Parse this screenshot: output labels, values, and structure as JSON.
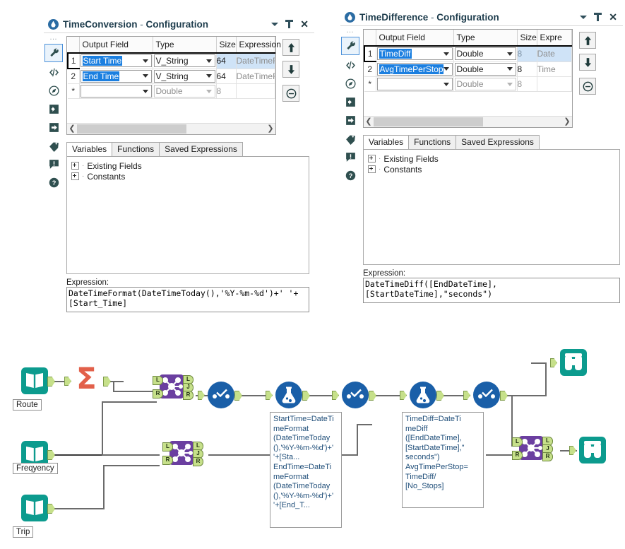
{
  "panels": [
    {
      "id": "time-conversion",
      "title": "TimeConversion",
      "title_sep": " - ",
      "title_suffix": "Configuration",
      "rail_icons": [
        "wrench-icon",
        "code-icon",
        "compass-icon",
        "import-icon",
        "export-icon",
        "tag-icon",
        "warning-icon",
        "help-icon"
      ],
      "grid": {
        "columns": [
          "",
          "Output Field",
          "Type",
          "Size",
          "Expression"
        ],
        "rows": [
          {
            "num": "1",
            "output_field": "Start Time",
            "type": "V_String",
            "size": "64",
            "expression": "DateTimeF",
            "selected": true
          },
          {
            "num": "2",
            "output_field": "End Time",
            "type": "V_String",
            "size": "64",
            "expression": "DateTimeF",
            "selected": false
          },
          {
            "num": "*",
            "output_field": "",
            "type": "Double",
            "size": "8",
            "expression": "",
            "selected": false
          }
        ]
      },
      "grid_buttons": [
        "move-up",
        "move-down",
        "delete"
      ],
      "tabs": [
        "Variables",
        "Functions",
        "Saved Expressions"
      ],
      "active_tab": "Variables",
      "tree_items": [
        "Existing Fields",
        "Constants"
      ],
      "expression_label": "Expression:",
      "expression": "DateTimeFormat(DateTimeToday(),'%Y-%m-%d')+' '+\n[Start_Time]"
    },
    {
      "id": "time-difference",
      "title": "TimeDifference",
      "title_sep": " - ",
      "title_suffix": "Configuration",
      "rail_icons": [
        "wrench-icon",
        "code-icon",
        "compass-icon",
        "import-icon",
        "export-icon",
        "tag-icon",
        "warning-icon",
        "help-icon"
      ],
      "grid": {
        "columns": [
          "",
          "Output Field",
          "Type",
          "Size",
          "Expre"
        ],
        "rows": [
          {
            "num": "1",
            "output_field": "TimeDiff",
            "type": "Double",
            "size": "8",
            "expression": "Date",
            "selected": true
          },
          {
            "num": "2",
            "output_field": "AvgTimePerStop",
            "type": "Double",
            "size": "8",
            "expression": "Time",
            "selected": false
          },
          {
            "num": "*",
            "output_field": "",
            "type": "Double",
            "size": "8",
            "expression": "",
            "selected": false
          }
        ]
      },
      "grid_buttons": [
        "move-up",
        "move-down",
        "delete"
      ],
      "tabs": [
        "Variables",
        "Functions",
        "Saved Expressions"
      ],
      "active_tab": "Variables",
      "tree_items": [
        "Existing Fields",
        "Constants"
      ],
      "expression_label": "Expression:",
      "expression": "DateTimeDiff([EndDateTime],\n[StartDateTime],\"seconds\")"
    }
  ],
  "canvas": {
    "node_labels": [
      {
        "name": "route-label",
        "text": "Route"
      },
      {
        "name": "frequency-label",
        "text": "Freqyency"
      },
      {
        "name": "trip-label",
        "text": "Trip"
      }
    ],
    "annotations": [
      {
        "name": "timeconversion-annotation",
        "text": "StartTime=DateTi\nmeFormat\n(DateTimeToday\n(),'%Y-%m-%d')+'\n'+[Sta...\nEndTime=DateTi\nmeFormat\n(DateTimeToday\n(),'%Y-%m-%d')+'\n'+[End_T..."
      },
      {
        "name": "timedifference-annotation",
        "text": "TimeDiff=DateTi\nmeDiff\n([EndDateTime],\n[StartDateTime],\"\nseconds\")\nAvgTimePerStop=\nTimeDiff/\n[No_Stops]"
      }
    ],
    "port_letters": {
      "left": "L",
      "join": "J",
      "right": "R"
    },
    "icon_names": [
      "input-data-icon",
      "summarize-icon",
      "join-icon",
      "select-icon",
      "formula-icon",
      "browse-icon"
    ]
  },
  "colors": {
    "accent_blue": "#1a5fa8",
    "teal": "#0c9b8e",
    "purple": "#6b3fa0",
    "orange": "#e2604a",
    "highlight": "#1b7fe0",
    "row_select": "#cfe3f7",
    "port_green": "#c6e08a"
  }
}
